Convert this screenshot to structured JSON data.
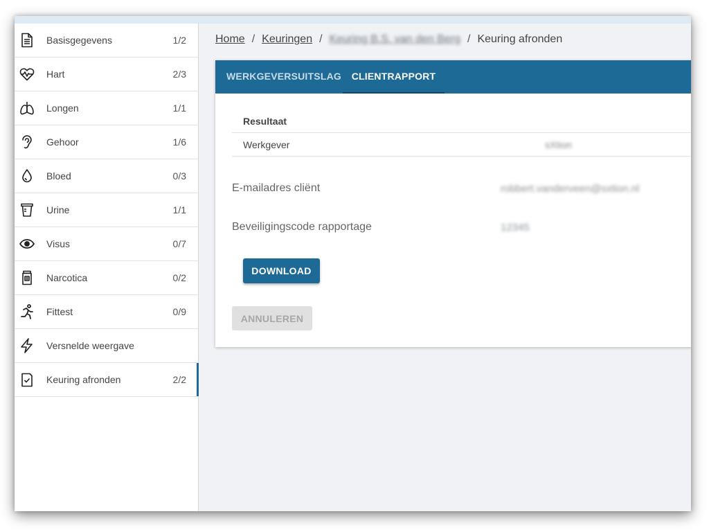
{
  "sidebar": {
    "items": [
      {
        "label": "Basisgegevens",
        "count": "1/2",
        "icon": "document-icon"
      },
      {
        "label": "Hart",
        "count": "2/3",
        "icon": "heart-pulse-icon"
      },
      {
        "label": "Longen",
        "count": "1/1",
        "icon": "lungs-icon"
      },
      {
        "label": "Gehoor",
        "count": "1/6",
        "icon": "ear-icon"
      },
      {
        "label": "Bloed",
        "count": "0/3",
        "icon": "blood-drop-icon"
      },
      {
        "label": "Urine",
        "count": "1/1",
        "icon": "urine-cup-icon"
      },
      {
        "label": "Visus",
        "count": "0/7",
        "icon": "eye-icon"
      },
      {
        "label": "Narcotica",
        "count": "0/2",
        "icon": "pill-bottle-icon"
      },
      {
        "label": "Fittest",
        "count": "0/9",
        "icon": "running-icon"
      },
      {
        "label": "Versnelde weergave",
        "count": "",
        "icon": "lightning-icon"
      },
      {
        "label": "Keuring afronden",
        "count": "2/2",
        "icon": "clipboard-check-icon",
        "active": true
      }
    ]
  },
  "breadcrumb": {
    "home": "Home",
    "keuringen": "Keuringen",
    "keuring": "Keuring B.S. van den Berg",
    "current": "Keuring afronden",
    "separator": "/"
  },
  "tabs": {
    "werkgever": "WERKGEVERSUITSLAG",
    "client": "CLIENTRAPPORT"
  },
  "result_table": {
    "header": "Resultaat",
    "rows": [
      {
        "label": "Werkgever",
        "value": "sXtion"
      }
    ]
  },
  "fields": {
    "email_label": "E-mailadres cliënt",
    "email_value": "robbert.vanderveen@sxtion.nl",
    "code_label": "Beveiligingscode rapportage",
    "code_value": "12345"
  },
  "buttons": {
    "download": "DOWNLOAD",
    "cancel": "ANNULEREN"
  },
  "colors": {
    "accent": "#1e6a96",
    "background": "#f1f2f5"
  }
}
